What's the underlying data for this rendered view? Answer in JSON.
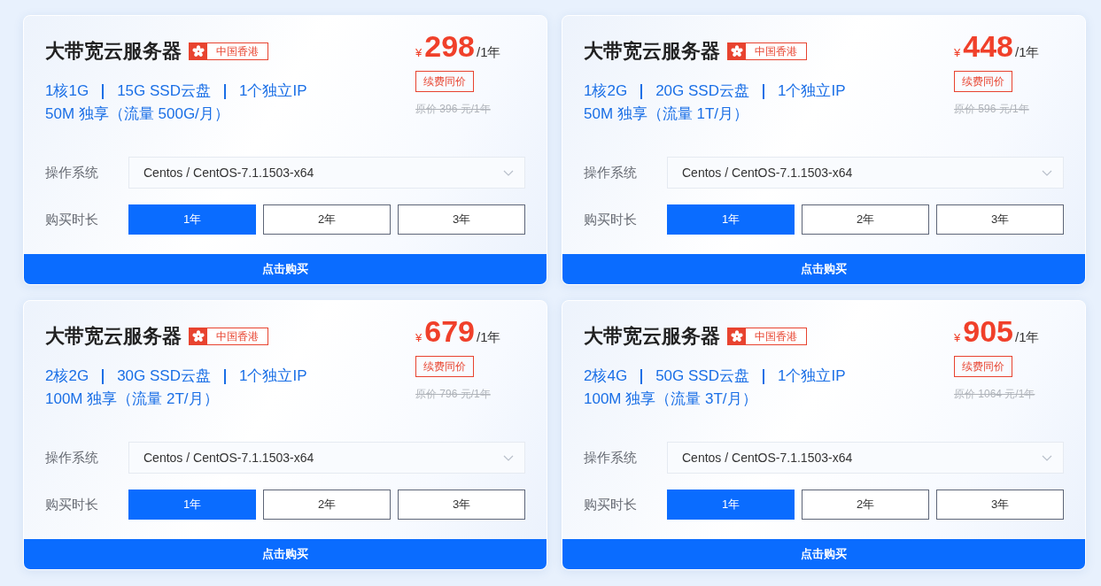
{
  "cards": [
    {
      "title": "大带宽云服务器",
      "region": "中国香港",
      "specs": [
        "1核1G",
        "15G SSD云盘",
        "1个独立IP"
      ],
      "bandwidth": "50M 独享（流量 500G/月）",
      "price": {
        "currency": "¥",
        "amount": "298",
        "period": "/1年"
      },
      "renew_tag": "续费同价",
      "original_price": "原价 396 元/1年",
      "os": {
        "label": "操作系统",
        "value": "Centos / CentOS-7.1.1503-x64"
      },
      "duration": {
        "label": "购买时长",
        "options": [
          {
            "label": "1年",
            "selected": true
          },
          {
            "label": "2年",
            "selected": false
          },
          {
            "label": "3年",
            "selected": false
          }
        ]
      },
      "buy_button": "点击购买"
    },
    {
      "title": "大带宽云服务器",
      "region": "中国香港",
      "specs": [
        "1核2G",
        "20G SSD云盘",
        "1个独立IP"
      ],
      "bandwidth": "50M 独享（流量 1T/月）",
      "price": {
        "currency": "¥",
        "amount": "448",
        "period": "/1年"
      },
      "renew_tag": "续费同价",
      "original_price": "原价 596 元/1年",
      "os": {
        "label": "操作系统",
        "value": "Centos / CentOS-7.1.1503-x64"
      },
      "duration": {
        "label": "购买时长",
        "options": [
          {
            "label": "1年",
            "selected": true
          },
          {
            "label": "2年",
            "selected": false
          },
          {
            "label": "3年",
            "selected": false
          }
        ]
      },
      "buy_button": "点击购买"
    },
    {
      "title": "大带宽云服务器",
      "region": "中国香港",
      "specs": [
        "2核2G",
        "30G SSD云盘",
        "1个独立IP"
      ],
      "bandwidth": "100M 独享（流量 2T/月）",
      "price": {
        "currency": "¥",
        "amount": "679",
        "period": "/1年"
      },
      "renew_tag": "续费同价",
      "original_price": "原价 796 元/1年",
      "os": {
        "label": "操作系统",
        "value": "Centos / CentOS-7.1.1503-x64"
      },
      "duration": {
        "label": "购买时长",
        "options": [
          {
            "label": "1年",
            "selected": true
          },
          {
            "label": "2年",
            "selected": false
          },
          {
            "label": "3年",
            "selected": false
          }
        ]
      },
      "buy_button": "点击购买"
    },
    {
      "title": "大带宽云服务器",
      "region": "中国香港",
      "specs": [
        "2核4G",
        "50G SSD云盘",
        "1个独立IP"
      ],
      "bandwidth": "100M 独享（流量 3T/月）",
      "price": {
        "currency": "¥",
        "amount": "905",
        "period": "/1年"
      },
      "renew_tag": "续费同价",
      "original_price": "原价 1064 元/1年",
      "os": {
        "label": "操作系统",
        "value": "Centos / CentOS-7.1.1503-x64"
      },
      "duration": {
        "label": "购买时长",
        "options": [
          {
            "label": "1年",
            "selected": true
          },
          {
            "label": "2年",
            "selected": false
          },
          {
            "label": "3年",
            "selected": false
          }
        ]
      },
      "buy_button": "点击购买"
    }
  ]
}
